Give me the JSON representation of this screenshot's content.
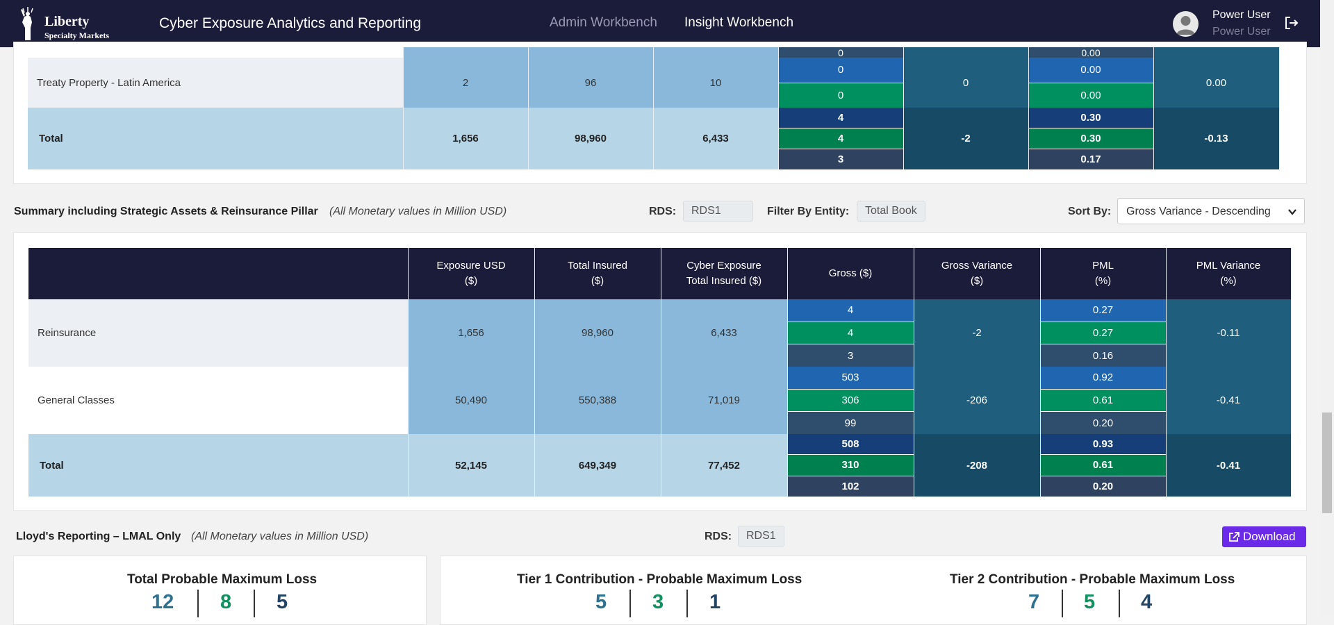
{
  "header": {
    "logo_line1": "Liberty",
    "logo_line2": "Specialty Markets",
    "app_title": "Cyber Exposure Analytics and Reporting",
    "tabs": [
      "Admin Workbench",
      "Insight Workbench"
    ],
    "active_tab": "Insight Workbench",
    "user_name": "Power User",
    "user_role": "Power User",
    "icons": [
      "user-avatar-icon",
      "logout-icon"
    ]
  },
  "top_table": {
    "partial_top_values": [
      "0",
      "0.00"
    ],
    "row": {
      "label": "Treaty Property - Latin America",
      "exposure": "2",
      "total_insured": "96",
      "cyber_total_insured": "10",
      "gross": [
        "0",
        "0"
      ],
      "gross_variance": "0",
      "pml": [
        "0.00",
        "0.00"
      ],
      "pml_variance": "0.00"
    },
    "total": {
      "label": "Total",
      "exposure": "1,656",
      "total_insured": "98,960",
      "cyber_total_insured": "6,433",
      "gross": [
        "4",
        "4",
        "3"
      ],
      "gross_variance": "-2",
      "pml": [
        "0.30",
        "0.30",
        "0.17"
      ],
      "pml_variance": "-0.13"
    }
  },
  "summary": {
    "title": "Summary including Strategic Assets & Reinsurance Pillar",
    "note": "(All Monetary values in Million USD)",
    "rds_label": "RDS:",
    "rds_value": "RDS1",
    "entity_label": "Filter By Entity:",
    "entity_value": "Total Book",
    "sort_label": "Sort By:",
    "sort_value": "Gross Variance - Descending",
    "columns": [
      {
        "l1": "Exposure USD",
        "l2": "($)"
      },
      {
        "l1": "Total Insured",
        "l2": "($)"
      },
      {
        "l1": "Cyber Exposure",
        "l2": "Total Insured ($)"
      },
      {
        "l1": "Gross ($)",
        "l2": ""
      },
      {
        "l1": "Gross Variance",
        "l2": "($)"
      },
      {
        "l1": "PML",
        "l2": "(%)"
      },
      {
        "l1": "PML Variance",
        "l2": "(%)"
      }
    ],
    "rows": [
      {
        "label": "Reinsurance",
        "exposure": "1,656",
        "total_insured": "98,960",
        "cyber_total_insured": "6,433",
        "gross": [
          "4",
          "4",
          "3"
        ],
        "gross_variance": "-2",
        "pml": [
          "0.27",
          "0.27",
          "0.16"
        ],
        "pml_variance": "-0.11"
      },
      {
        "label": "General Classes",
        "exposure": "50,490",
        "total_insured": "550,388",
        "cyber_total_insured": "71,019",
        "gross": [
          "503",
          "306",
          "99"
        ],
        "gross_variance": "-206",
        "pml": [
          "0.92",
          "0.61",
          "0.20"
        ],
        "pml_variance": "-0.41"
      }
    ],
    "total": {
      "label": "Total",
      "exposure": "52,145",
      "total_insured": "649,349",
      "cyber_total_insured": "77,452",
      "gross": [
        "508",
        "310",
        "102"
      ],
      "gross_variance": "-208",
      "pml": [
        "0.93",
        "0.61",
        "0.20"
      ],
      "pml_variance": "-0.41"
    }
  },
  "lloyds": {
    "title": "Lloyd's Reporting – LMAL Only",
    "note": "(All Monetary values in Million USD)",
    "rds_label": "RDS:",
    "rds_value": "RDS1",
    "download_label": "Download",
    "kpis": [
      {
        "title": "Total Probable Maximum Loss",
        "values": [
          "12",
          "8",
          "5"
        ]
      },
      {
        "title": "Tier 1 Contribution - Probable Maximum Loss",
        "values": [
          "5",
          "3",
          "1"
        ]
      },
      {
        "title": "Tier 2 Contribution - Probable Maximum Loss",
        "values": [
          "7",
          "5",
          "4"
        ]
      }
    ]
  },
  "colors": {
    "nav": "#1b1b3a",
    "accent": "#6b2fe0",
    "blue": "#2065b0",
    "green": "#009060",
    "slate": "#2f4d6c"
  }
}
